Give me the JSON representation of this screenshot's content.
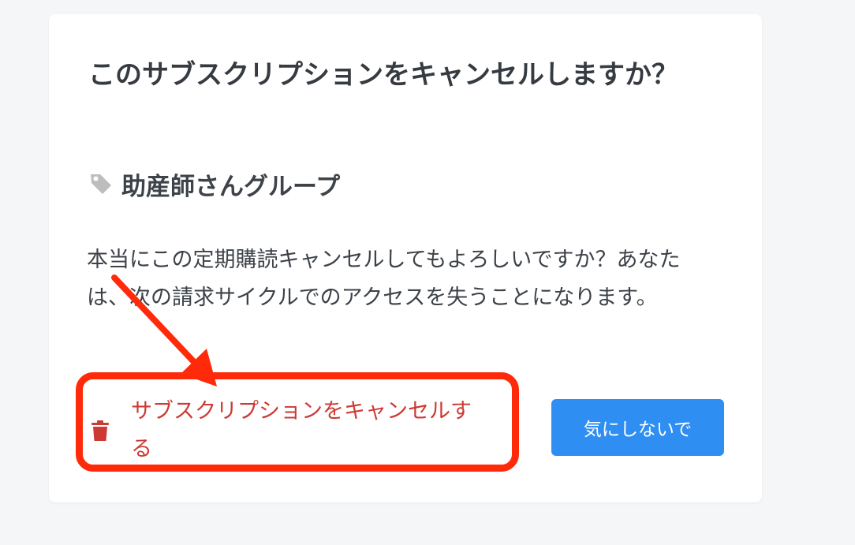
{
  "dialog": {
    "title": "このサブスクリプションをキャンセルしますか？",
    "group_icon": "tag-icon",
    "group_name": "助産師さんグループ",
    "message": "本当にこの定期購読キャンセルしてもよろしいですか？あなたは、次の請求サイクルでのアクセスを失うことになります。",
    "cancel_button": {
      "icon": "trash-icon",
      "label": "サブスクリプションをキャンセルする"
    },
    "keep_button": {
      "label": "気にしないで"
    }
  },
  "annotation": {
    "color": "#ff2a0a",
    "type": "arrow-and-highlight-box"
  },
  "colors": {
    "danger": "#cc3a33",
    "primary": "#2f8ef2",
    "background": "#f5f6f8",
    "card": "#ffffff"
  }
}
